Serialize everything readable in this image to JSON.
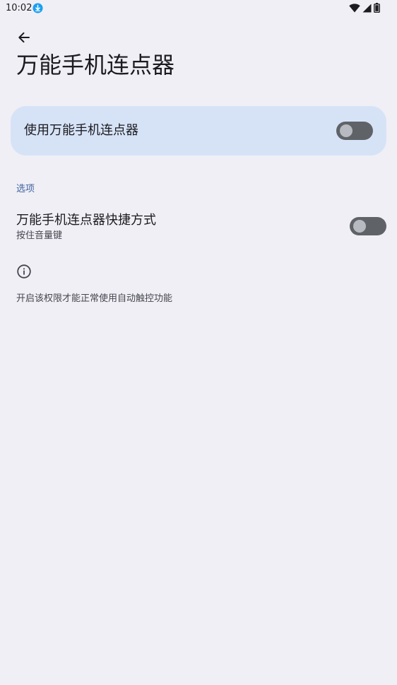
{
  "status_bar": {
    "time": "10:02",
    "icons": [
      "download-icon",
      "wifi-icon",
      "signal-icon",
      "battery-icon"
    ],
    "download_color": "#1a9ff0"
  },
  "header": {
    "back_icon": "arrow-back-icon",
    "title": "万能手机连点器"
  },
  "main_toggle": {
    "label": "使用万能手机连点器",
    "on": false,
    "card_color": "#d6e3f7"
  },
  "options": {
    "section_title": "选项",
    "shortcut": {
      "title": "万能手机连点器快捷方式",
      "subtitle": "按住音量键",
      "on": false
    }
  },
  "info": {
    "icon": "info-icon",
    "text": "开启该权限才能正常使用自动触控功能"
  },
  "colors": {
    "background": "#f0eff5",
    "accent": "#3f62a0",
    "switch_track_off": "#5f6368"
  }
}
